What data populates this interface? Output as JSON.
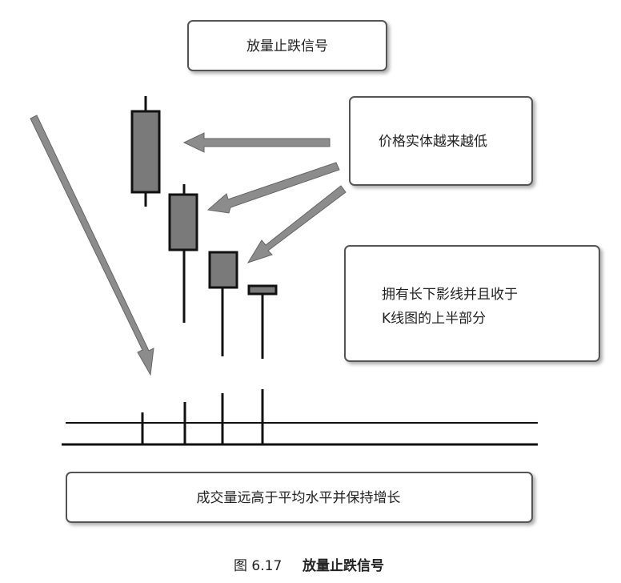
{
  "title_box": {
    "text": "放量止跌信号"
  },
  "callout_top": {
    "text": "价格实体越来越低"
  },
  "callout_middle": {
    "line1": "拥有长下影线并且收于",
    "line2": "K线图的上半部分"
  },
  "callout_bottom": {
    "text": "成交量远高于平均水平并保持增长"
  },
  "caption": {
    "number": "图 6.17",
    "title": "放量止跌信号"
  },
  "colors": {
    "candle_fill": "#7a7a7a",
    "arrow_fill": "#8c8c8c",
    "line": "#111111",
    "box_border": "#555555"
  }
}
